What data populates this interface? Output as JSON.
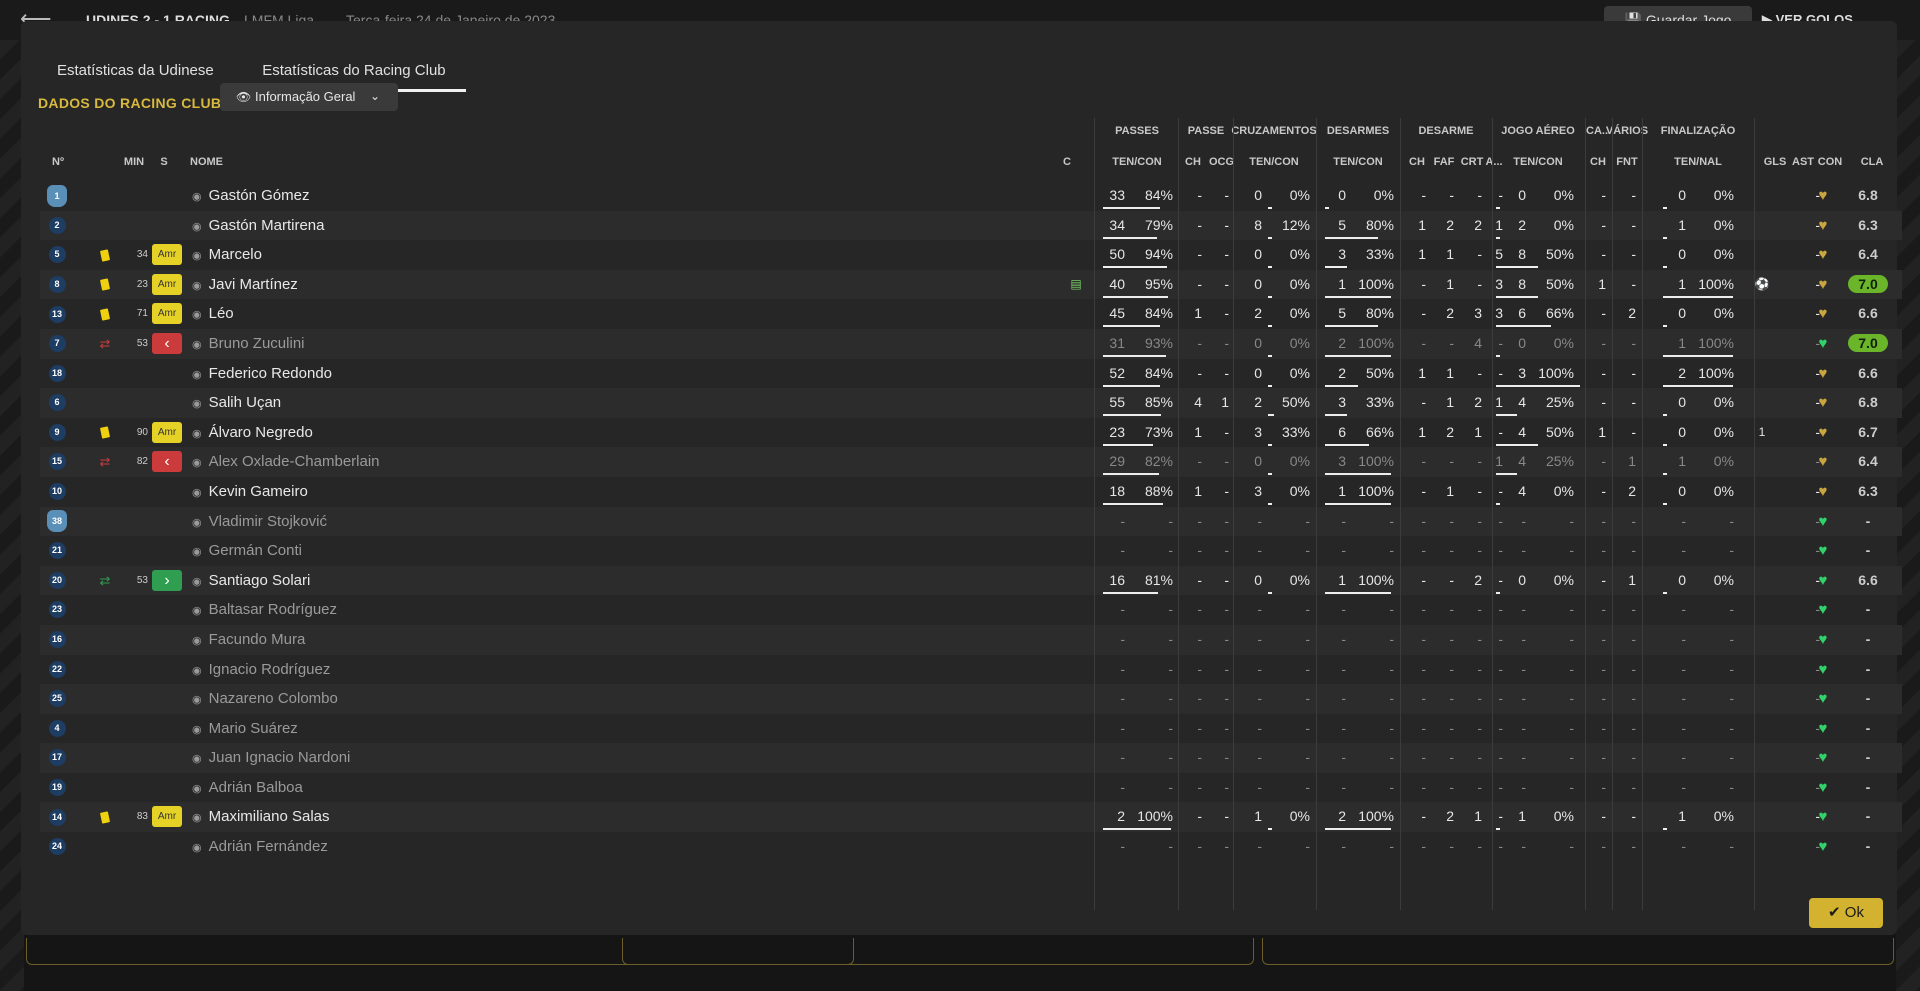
{
  "topbar": {
    "match": "UDINES  2 - 1  RACING",
    "league": "LMFM Liga",
    "date": "Terça-feira 24 de Janeiro de 2023",
    "save_label": "Guardar Jogo",
    "goals_label": "VER GOLOS"
  },
  "tabs": [
    "Estatísticas da Udinese",
    "Estatísticas do Racing Club"
  ],
  "section_title": "DADOS DO RACING CLUB",
  "view_select": "Informação Geral",
  "header_groups": [
    "PASSES",
    "PASSE",
    "CRUZAMENTOS",
    "DESARMES",
    "DESARME",
    "JOGO AÉREO",
    "CA...",
    "VÁRIOS",
    "FINALIZAÇÃO"
  ],
  "header_sub": [
    "Nº",
    "MIN",
    "S",
    "NOME",
    "C",
    "TEN/CON",
    "CH",
    "OCG",
    "TEN/CON",
    "TEN/CON",
    "CH",
    "FAF",
    "CRT",
    "A...",
    "TEN/CON",
    "CH",
    "FNT",
    "TEN/NAL",
    "GLS",
    "AST",
    "CON",
    "CLA"
  ],
  "ok_label": "Ok",
  "players": [
    {
      "no": "1",
      "gk": true,
      "ev": "",
      "min": "",
      "s": "",
      "name": "Gastón Gómez",
      "dim": false,
      "c": "",
      "pas": [
        "33",
        "84%"
      ],
      "pch": "-",
      "ocg": "-",
      "cru": [
        "0",
        "0%"
      ],
      "des": [
        "0",
        "0%"
      ],
      "dch": "-",
      "faf": "-",
      "crt": "-",
      "da": "-",
      "aer": [
        "0",
        "0%"
      ],
      "ach": "-",
      "fnt": "-",
      "fin": [
        "0",
        "0%"
      ],
      "gls": "",
      "ast": "-",
      "cla": "6.8",
      "best": false,
      "passpct": 0.84,
      "crupct": 0,
      "despct": 0,
      "aerpct": 0,
      "finpct": 0
    },
    {
      "no": "2",
      "gk": false,
      "ev": "",
      "min": "",
      "s": "",
      "name": "Gastón Martirena",
      "dim": false,
      "c": "",
      "pas": [
        "34",
        "79%"
      ],
      "pch": "-",
      "ocg": "-",
      "cru": [
        "8",
        "12%"
      ],
      "des": [
        "5",
        "80%"
      ],
      "dch": "1",
      "faf": "2",
      "crt": "2",
      "da": "1",
      "aer": [
        "2",
        "0%"
      ],
      "ach": "-",
      "fnt": "-",
      "fin": [
        "1",
        "0%"
      ],
      "gls": "",
      "ast": "-",
      "cla": "6.3",
      "best": false,
      "passpct": 0.79,
      "crupct": 0.12,
      "despct": 0.8,
      "aerpct": 0,
      "finpct": 0
    },
    {
      "no": "5",
      "gk": false,
      "ev": "yellow",
      "min": "34",
      "s": "amr",
      "name": "Marcelo",
      "dim": false,
      "c": "",
      "pas": [
        "50",
        "94%"
      ],
      "pch": "-",
      "ocg": "-",
      "cru": [
        "0",
        "0%"
      ],
      "des": [
        "3",
        "33%"
      ],
      "dch": "1",
      "faf": "1",
      "crt": "-",
      "da": "5",
      "aer": [
        "8",
        "50%"
      ],
      "ach": "-",
      "fnt": "-",
      "fin": [
        "0",
        "0%"
      ],
      "gls": "",
      "ast": "-",
      "cla": "6.4",
      "best": false,
      "passpct": 0.94,
      "crupct": 0,
      "despct": 0.33,
      "aerpct": 0.5,
      "finpct": 0
    },
    {
      "no": "8",
      "gk": false,
      "ev": "yellow",
      "min": "23",
      "s": "amr",
      "name": "Javi Martínez",
      "dim": false,
      "c": "shirt",
      "pas": [
        "40",
        "95%"
      ],
      "pch": "-",
      "ocg": "-",
      "cru": [
        "0",
        "0%"
      ],
      "des": [
        "1",
        "100%"
      ],
      "dch": "-",
      "faf": "1",
      "crt": "-",
      "da": "3",
      "aer": [
        "8",
        "50%"
      ],
      "ach": "1",
      "fnt": "-",
      "fin": [
        "1",
        "100%"
      ],
      "gls": "ball",
      "ast": "-",
      "cla": "7.0",
      "best": true,
      "passpct": 0.95,
      "crupct": 0,
      "despct": 1,
      "aerpct": 0.5,
      "finpct": 1
    },
    {
      "no": "13",
      "gk": false,
      "ev": "yellow",
      "min": "71",
      "s": "amr",
      "name": "Léo",
      "dim": false,
      "c": "",
      "pas": [
        "45",
        "84%"
      ],
      "pch": "1",
      "ocg": "-",
      "cru": [
        "2",
        "0%"
      ],
      "des": [
        "5",
        "80%"
      ],
      "dch": "-",
      "faf": "2",
      "crt": "3",
      "da": "3",
      "aer": [
        "6",
        "66%"
      ],
      "ach": "-",
      "fnt": "2",
      "fin": [
        "0",
        "0%"
      ],
      "gls": "",
      "ast": "-",
      "cla": "6.6",
      "best": false,
      "passpct": 0.84,
      "crupct": 0,
      "despct": 0.8,
      "aerpct": 0.66,
      "finpct": 0
    },
    {
      "no": "7",
      "gk": false,
      "ev": "sub-out",
      "min": "53",
      "s": "out",
      "name": "Bruno Zuculini",
      "dim": true,
      "c": "",
      "pas": [
        "31",
        "93%"
      ],
      "pch": "-",
      "ocg": "-",
      "cru": [
        "0",
        "0%"
      ],
      "des": [
        "2",
        "100%"
      ],
      "dch": "-",
      "faf": "-",
      "crt": "4",
      "da": "-",
      "aer": [
        "0",
        "0%"
      ],
      "ach": "-",
      "fnt": "-",
      "fin": [
        "1",
        "100%"
      ],
      "gls": "",
      "ast": "-",
      "cla": "7.0",
      "best": true,
      "passpct": 0.93,
      "crupct": 0,
      "despct": 1,
      "aerpct": 0,
      "finpct": 1
    },
    {
      "no": "18",
      "gk": false,
      "ev": "",
      "min": "",
      "s": "",
      "name": "Federico Redondo",
      "dim": false,
      "c": "",
      "pas": [
        "52",
        "84%"
      ],
      "pch": "-",
      "ocg": "-",
      "cru": [
        "0",
        "0%"
      ],
      "des": [
        "2",
        "50%"
      ],
      "dch": "1",
      "faf": "1",
      "crt": "-",
      "da": "-",
      "aer": [
        "3",
        "100%"
      ],
      "ach": "-",
      "fnt": "-",
      "fin": [
        "2",
        "100%"
      ],
      "gls": "",
      "ast": "-",
      "cla": "6.6",
      "best": false,
      "passpct": 0.84,
      "crupct": 0,
      "despct": 0.5,
      "aerpct": 1,
      "finpct": 1
    },
    {
      "no": "6",
      "gk": false,
      "ev": "",
      "min": "",
      "s": "",
      "name": "Salih Uçan",
      "dim": false,
      "c": "",
      "pas": [
        "55",
        "85%"
      ],
      "pch": "4",
      "ocg": "1",
      "cru": [
        "2",
        "50%"
      ],
      "des": [
        "3",
        "33%"
      ],
      "dch": "-",
      "faf": "1",
      "crt": "2",
      "da": "1",
      "aer": [
        "4",
        "25%"
      ],
      "ach": "-",
      "fnt": "-",
      "fin": [
        "0",
        "0%"
      ],
      "gls": "",
      "ast": "-",
      "cla": "6.8",
      "best": false,
      "passpct": 0.85,
      "crupct": 0.5,
      "despct": 0.33,
      "aerpct": 0.25,
      "finpct": 0
    },
    {
      "no": "9",
      "gk": false,
      "ev": "yellow",
      "min": "90",
      "s": "amr",
      "name": "Álvaro Negredo",
      "dim": false,
      "c": "",
      "pas": [
        "23",
        "73%"
      ],
      "pch": "1",
      "ocg": "-",
      "cru": [
        "3",
        "33%"
      ],
      "des": [
        "6",
        "66%"
      ],
      "dch": "1",
      "faf": "2",
      "crt": "1",
      "da": "-",
      "aer": [
        "4",
        "50%"
      ],
      "ach": "1",
      "fnt": "-",
      "fin": [
        "0",
        "0%"
      ],
      "gls": "1",
      "ast": "-",
      "cla": "6.7",
      "best": false,
      "passpct": 0.73,
      "crupct": 0.33,
      "despct": 0.66,
      "aerpct": 0.5,
      "finpct": 0
    },
    {
      "no": "15",
      "gk": false,
      "ev": "sub-out",
      "min": "82",
      "s": "out",
      "name": "Alex Oxlade-Chamberlain",
      "dim": true,
      "c": "",
      "pas": [
        "29",
        "82%"
      ],
      "pch": "-",
      "ocg": "-",
      "cru": [
        "0",
        "0%"
      ],
      "des": [
        "3",
        "100%"
      ],
      "dch": "-",
      "faf": "-",
      "crt": "-",
      "da": "1",
      "aer": [
        "4",
        "25%"
      ],
      "ach": "-",
      "fnt": "1",
      "fin": [
        "1",
        "0%"
      ],
      "gls": "",
      "ast": "-",
      "cla": "6.4",
      "best": false,
      "passpct": 0.82,
      "crupct": 0,
      "despct": 1,
      "aerpct": 0.25,
      "finpct": 0
    },
    {
      "no": "10",
      "gk": false,
      "ev": "",
      "min": "",
      "s": "",
      "name": "Kevin Gameiro",
      "dim": false,
      "c": "",
      "pas": [
        "18",
        "88%"
      ],
      "pch": "1",
      "ocg": "-",
      "cru": [
        "3",
        "0%"
      ],
      "des": [
        "1",
        "100%"
      ],
      "dch": "-",
      "faf": "1",
      "crt": "-",
      "da": "-",
      "aer": [
        "4",
        "0%"
      ],
      "ach": "-",
      "fnt": "2",
      "fin": [
        "0",
        "0%"
      ],
      "gls": "",
      "ast": "-",
      "cla": "6.3",
      "best": false,
      "passpct": 0.88,
      "crupct": 0,
      "despct": 1,
      "aerpct": 0,
      "finpct": 0
    },
    {
      "no": "38",
      "gk": true,
      "ev": "",
      "min": "",
      "s": "",
      "name": "Vladimir Stojković",
      "dim": true,
      "c": "",
      "pas": [
        "-",
        "-"
      ],
      "pch": "-",
      "ocg": "-",
      "cru": [
        "-",
        "-"
      ],
      "des": [
        "-",
        "-"
      ],
      "dch": "-",
      "faf": "-",
      "crt": "-",
      "da": "-",
      "aer": [
        "-",
        "-"
      ],
      "ach": "-",
      "fnt": "-",
      "fin": [
        "-",
        "-"
      ],
      "gls": "",
      "ast": "-",
      "cla": "-",
      "best": false,
      "passpct": 0,
      "crupct": 0,
      "despct": 0,
      "aerpct": 0,
      "finpct": 0
    },
    {
      "no": "21",
      "gk": false,
      "ev": "",
      "min": "",
      "s": "",
      "name": "Germán Conti",
      "dim": true,
      "c": "",
      "pas": [
        "-",
        "-"
      ],
      "pch": "-",
      "ocg": "-",
      "cru": [
        "-",
        "-"
      ],
      "des": [
        "-",
        "-"
      ],
      "dch": "-",
      "faf": "-",
      "crt": "-",
      "da": "-",
      "aer": [
        "-",
        "-"
      ],
      "ach": "-",
      "fnt": "-",
      "fin": [
        "-",
        "-"
      ],
      "gls": "",
      "ast": "-",
      "cla": "-",
      "best": false,
      "passpct": 0,
      "crupct": 0,
      "despct": 0,
      "aerpct": 0,
      "finpct": 0
    },
    {
      "no": "20",
      "gk": false,
      "ev": "sub-in",
      "min": "53",
      "s": "in",
      "name": "Santiago Solari",
      "dim": false,
      "c": "",
      "pas": [
        "16",
        "81%"
      ],
      "pch": "-",
      "ocg": "-",
      "cru": [
        "0",
        "0%"
      ],
      "des": [
        "1",
        "100%"
      ],
      "dch": "-",
      "faf": "-",
      "crt": "2",
      "da": "-",
      "aer": [
        "0",
        "0%"
      ],
      "ach": "-",
      "fnt": "1",
      "fin": [
        "0",
        "0%"
      ],
      "gls": "",
      "ast": "-",
      "cla": "6.6",
      "best": false,
      "passpct": 0.81,
      "crupct": 0,
      "despct": 1,
      "aerpct": 0,
      "finpct": 0
    },
    {
      "no": "23",
      "gk": false,
      "ev": "",
      "min": "",
      "s": "",
      "name": "Baltasar Rodríguez",
      "dim": true,
      "c": "",
      "pas": [
        "-",
        "-"
      ],
      "pch": "-",
      "ocg": "-",
      "cru": [
        "-",
        "-"
      ],
      "des": [
        "-",
        "-"
      ],
      "dch": "-",
      "faf": "-",
      "crt": "-",
      "da": "-",
      "aer": [
        "-",
        "-"
      ],
      "ach": "-",
      "fnt": "-",
      "fin": [
        "-",
        "-"
      ],
      "gls": "",
      "ast": "-",
      "cla": "-",
      "best": false,
      "passpct": 0,
      "crupct": 0,
      "despct": 0,
      "aerpct": 0,
      "finpct": 0
    },
    {
      "no": "16",
      "gk": false,
      "ev": "",
      "min": "",
      "s": "",
      "name": "Facundo Mura",
      "dim": true,
      "c": "",
      "pas": [
        "-",
        "-"
      ],
      "pch": "-",
      "ocg": "-",
      "cru": [
        "-",
        "-"
      ],
      "des": [
        "-",
        "-"
      ],
      "dch": "-",
      "faf": "-",
      "crt": "-",
      "da": "-",
      "aer": [
        "-",
        "-"
      ],
      "ach": "-",
      "fnt": "-",
      "fin": [
        "-",
        "-"
      ],
      "gls": "",
      "ast": "-",
      "cla": "-",
      "best": false,
      "passpct": 0,
      "crupct": 0,
      "despct": 0,
      "aerpct": 0,
      "finpct": 0
    },
    {
      "no": "22",
      "gk": false,
      "ev": "",
      "min": "",
      "s": "",
      "name": "Ignacio Rodríguez",
      "dim": true,
      "c": "",
      "pas": [
        "-",
        "-"
      ],
      "pch": "-",
      "ocg": "-",
      "cru": [
        "-",
        "-"
      ],
      "des": [
        "-",
        "-"
      ],
      "dch": "-",
      "faf": "-",
      "crt": "-",
      "da": "-",
      "aer": [
        "-",
        "-"
      ],
      "ach": "-",
      "fnt": "-",
      "fin": [
        "-",
        "-"
      ],
      "gls": "",
      "ast": "-",
      "cla": "-",
      "best": false,
      "passpct": 0,
      "crupct": 0,
      "despct": 0,
      "aerpct": 0,
      "finpct": 0
    },
    {
      "no": "25",
      "gk": false,
      "ev": "",
      "min": "",
      "s": "",
      "name": "Nazareno Colombo",
      "dim": true,
      "c": "",
      "pas": [
        "-",
        "-"
      ],
      "pch": "-",
      "ocg": "-",
      "cru": [
        "-",
        "-"
      ],
      "des": [
        "-",
        "-"
      ],
      "dch": "-",
      "faf": "-",
      "crt": "-",
      "da": "-",
      "aer": [
        "-",
        "-"
      ],
      "ach": "-",
      "fnt": "-",
      "fin": [
        "-",
        "-"
      ],
      "gls": "",
      "ast": "-",
      "cla": "-",
      "best": false,
      "passpct": 0,
      "crupct": 0,
      "despct": 0,
      "aerpct": 0,
      "finpct": 0
    },
    {
      "no": "4",
      "gk": false,
      "ev": "",
      "min": "",
      "s": "",
      "name": "Mario Suárez",
      "dim": true,
      "c": "",
      "pas": [
        "-",
        "-"
      ],
      "pch": "-",
      "ocg": "-",
      "cru": [
        "-",
        "-"
      ],
      "des": [
        "-",
        "-"
      ],
      "dch": "-",
      "faf": "-",
      "crt": "-",
      "da": "-",
      "aer": [
        "-",
        "-"
      ],
      "ach": "-",
      "fnt": "-",
      "fin": [
        "-",
        "-"
      ],
      "gls": "",
      "ast": "-",
      "cla": "-",
      "best": false,
      "passpct": 0,
      "crupct": 0,
      "despct": 0,
      "aerpct": 0,
      "finpct": 0
    },
    {
      "no": "17",
      "gk": false,
      "ev": "",
      "min": "",
      "s": "",
      "name": "Juan Ignacio Nardoni",
      "dim": true,
      "c": "",
      "pas": [
        "-",
        "-"
      ],
      "pch": "-",
      "ocg": "-",
      "cru": [
        "-",
        "-"
      ],
      "des": [
        "-",
        "-"
      ],
      "dch": "-",
      "faf": "-",
      "crt": "-",
      "da": "-",
      "aer": [
        "-",
        "-"
      ],
      "ach": "-",
      "fnt": "-",
      "fin": [
        "-",
        "-"
      ],
      "gls": "",
      "ast": "-",
      "cla": "-",
      "best": false,
      "passpct": 0,
      "crupct": 0,
      "despct": 0,
      "aerpct": 0,
      "finpct": 0
    },
    {
      "no": "19",
      "gk": false,
      "ev": "",
      "min": "",
      "s": "",
      "name": "Adrián Balboa",
      "dim": true,
      "c": "",
      "pas": [
        "-",
        "-"
      ],
      "pch": "-",
      "ocg": "-",
      "cru": [
        "-",
        "-"
      ],
      "des": [
        "-",
        "-"
      ],
      "dch": "-",
      "faf": "-",
      "crt": "-",
      "da": "-",
      "aer": [
        "-",
        "-"
      ],
      "ach": "-",
      "fnt": "-",
      "fin": [
        "-",
        "-"
      ],
      "gls": "",
      "ast": "-",
      "cla": "-",
      "best": false,
      "passpct": 0,
      "crupct": 0,
      "despct": 0,
      "aerpct": 0,
      "finpct": 0
    },
    {
      "no": "14",
      "gk": false,
      "ev": "yellow",
      "min": "83",
      "s": "amr",
      "name": "Maximiliano Salas",
      "dim": false,
      "c": "",
      "pas": [
        "2",
        "100%"
      ],
      "pch": "-",
      "ocg": "-",
      "cru": [
        "1",
        "0%"
      ],
      "des": [
        "2",
        "100%"
      ],
      "dch": "-",
      "faf": "2",
      "crt": "1",
      "da": "-",
      "aer": [
        "1",
        "0%"
      ],
      "ach": "-",
      "fnt": "-",
      "fin": [
        "1",
        "0%"
      ],
      "gls": "",
      "ast": "-",
      "cla": "-",
      "best": false,
      "passpct": 1,
      "crupct": 0,
      "despct": 1,
      "aerpct": 0,
      "finpct": 0
    },
    {
      "no": "24",
      "gk": false,
      "ev": "",
      "min": "",
      "s": "",
      "name": "Adrián Fernández",
      "dim": true,
      "c": "",
      "pas": [
        "-",
        "-"
      ],
      "pch": "-",
      "ocg": "-",
      "cru": [
        "-",
        "-"
      ],
      "des": [
        "-",
        "-"
      ],
      "dch": "-",
      "faf": "-",
      "crt": "-",
      "da": "-",
      "aer": [
        "-",
        "-"
      ],
      "ach": "-",
      "fnt": "-",
      "fin": [
        "-",
        "-"
      ],
      "gls": "",
      "ast": "-",
      "cla": "-",
      "best": false,
      "passpct": 0,
      "crupct": 0,
      "despct": 0,
      "aerpct": 0,
      "finpct": 0
    }
  ],
  "colors": {
    "accent": "#d8b93e",
    "yellow_card": "#f0d10f",
    "sub_out": "#cc3b3b",
    "sub_in": "#2f9e50",
    "best_rating": "#6bb52a",
    "morale_good": "#2fd36a",
    "morale_mid": "#c9a640"
  },
  "morale": [
    "mid",
    "mid",
    "mid",
    "mid",
    "mid",
    "good",
    "mid",
    "mid",
    "mid",
    "mid",
    "mid",
    "good",
    "good",
    "good",
    "good",
    "good",
    "good",
    "good",
    "good",
    "good",
    "good",
    "good",
    "good"
  ]
}
